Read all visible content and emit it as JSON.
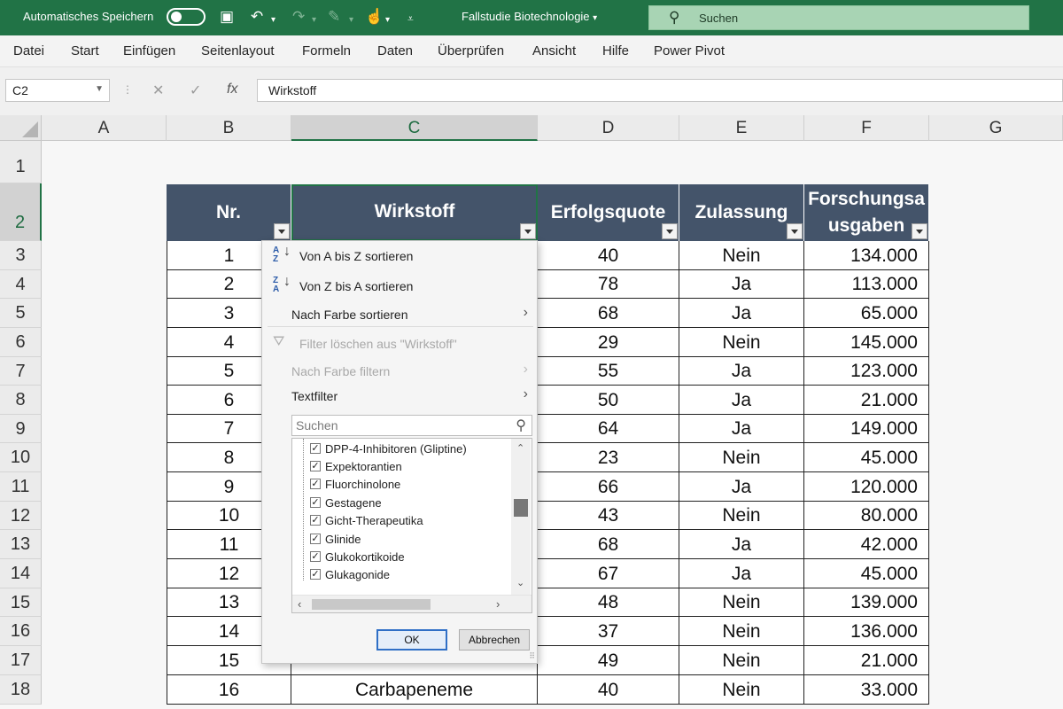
{
  "titlebar": {
    "autosave_label": "Automatisches Speichern",
    "document_title": "Fallstudie Biotechnologie",
    "search_label": "Suchen"
  },
  "ribbon": {
    "tabs": [
      "Datei",
      "Start",
      "Einfügen",
      "Seitenlayout",
      "Formeln",
      "Daten",
      "Überprüfen",
      "Ansicht",
      "Hilfe",
      "Power Pivot"
    ]
  },
  "formula_bar": {
    "name_box": "C2",
    "formula": "Wirkstoff",
    "fx": "fx"
  },
  "columns": [
    "A",
    "B",
    "C",
    "D",
    "E",
    "F",
    "G"
  ],
  "rows": [
    "1",
    "2",
    "3",
    "4",
    "5",
    "6",
    "7",
    "8",
    "9",
    "10",
    "11",
    "12",
    "13",
    "14",
    "15",
    "16",
    "17",
    "18"
  ],
  "table": {
    "headers": {
      "nr": "Nr.",
      "wirkstoff": "Wirkstoff",
      "erfolgsquote": "Erfolgsquote",
      "zulassung": "Zulassung",
      "forschung_line1": "Forschungsa",
      "forschung_line2": "usgaben"
    },
    "rows": [
      {
        "nr": "1",
        "erfolg": "40",
        "zul": "Nein",
        "fa": "134.000"
      },
      {
        "nr": "2",
        "erfolg": "78",
        "zul": "Ja",
        "fa": "113.000"
      },
      {
        "nr": "3",
        "erfolg": "68",
        "zul": "Ja",
        "fa": "65.000"
      },
      {
        "nr": "4",
        "erfolg": "29",
        "zul": "Nein",
        "fa": "145.000"
      },
      {
        "nr": "5",
        "erfolg": "55",
        "zul": "Ja",
        "fa": "123.000"
      },
      {
        "nr": "6",
        "erfolg": "50",
        "zul": "Ja",
        "fa": "21.000"
      },
      {
        "nr": "7",
        "erfolg": "64",
        "zul": "Ja",
        "fa": "149.000"
      },
      {
        "nr": "8",
        "erfolg": "23",
        "zul": "Nein",
        "fa": "45.000"
      },
      {
        "nr": "9",
        "erfolg": "66",
        "zul": "Ja",
        "fa": "120.000"
      },
      {
        "nr": "10",
        "erfolg": "43",
        "zul": "Nein",
        "fa": "80.000"
      },
      {
        "nr": "11",
        "erfolg": "68",
        "zul": "Ja",
        "fa": "42.000"
      },
      {
        "nr": "12",
        "erfolg": "67",
        "zul": "Ja",
        "fa": "45.000"
      },
      {
        "nr": "13",
        "erfolg": "48",
        "zul": "Nein",
        "fa": "139.000"
      },
      {
        "nr": "14",
        "erfolg": "37",
        "zul": "Nein",
        "fa": "136.000"
      },
      {
        "nr": "15",
        "erfolg": "49",
        "zul": "Nein",
        "fa": "21.000"
      },
      {
        "nr": "16",
        "erfolg": "40",
        "zul": "Nein",
        "fa": "33.000",
        "wirkstoff": "Carbapeneme"
      }
    ]
  },
  "filter_menu": {
    "sort_az": "Von A bis Z sortieren",
    "sort_za": "Von Z bis A sortieren",
    "sort_color": "Nach Farbe sortieren",
    "clear_filter": "Filter löschen aus \"Wirkstoff\"",
    "filter_color": "Nach Farbe filtern",
    "text_filter": "Textfilter",
    "search_placeholder": "Suchen",
    "items": [
      "DPP-4-Inhibitoren (Gliptine)",
      "Expektorantien",
      "Fluorchinolone",
      "Gestagene",
      "Gicht-Therapeutika",
      "Glinide",
      "Glukokortikoide",
      "Glukagonide"
    ],
    "ok": "OK",
    "cancel": "Abbrechen"
  },
  "colors": {
    "accent": "#217346",
    "table_header": "#44546a"
  }
}
